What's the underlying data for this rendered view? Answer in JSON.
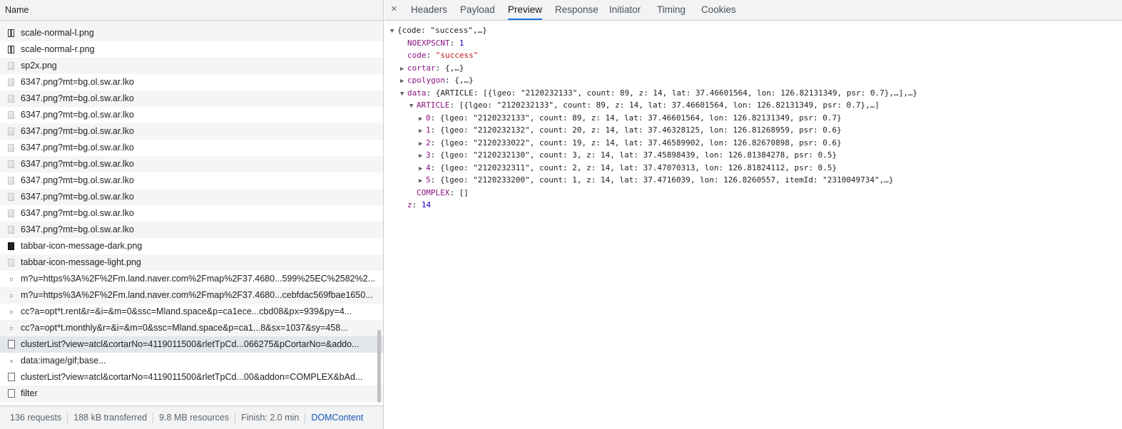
{
  "network": {
    "header": "Name",
    "requests": [
      {
        "name": "scale-normal-l.png",
        "icon": "bar-image-icon",
        "bg": "alt"
      },
      {
        "name": "scale-normal-r.png",
        "icon": "bar-image-icon",
        "bg": ""
      },
      {
        "name": "sp2x.png",
        "icon": "image-icon",
        "bg": "alt"
      },
      {
        "name": "6347.png?mt=bg.ol.sw.ar.lko",
        "icon": "image-icon",
        "bg": ""
      },
      {
        "name": "6347.png?mt=bg.ol.sw.ar.lko",
        "icon": "image-icon",
        "bg": "alt"
      },
      {
        "name": "6347.png?mt=bg.ol.sw.ar.lko",
        "icon": "image-icon",
        "bg": ""
      },
      {
        "name": "6347.png?mt=bg.ol.sw.ar.lko",
        "icon": "image-icon",
        "bg": "alt"
      },
      {
        "name": "6347.png?mt=bg.ol.sw.ar.lko",
        "icon": "image-icon",
        "bg": ""
      },
      {
        "name": "6347.png?mt=bg.ol.sw.ar.lko",
        "icon": "image-icon",
        "bg": "alt"
      },
      {
        "name": "6347.png?mt=bg.ol.sw.ar.lko",
        "icon": "image-icon",
        "bg": ""
      },
      {
        "name": "6347.png?mt=bg.ol.sw.ar.lko",
        "icon": "image-icon",
        "bg": "alt"
      },
      {
        "name": "6347.png?mt=bg.ol.sw.ar.lko",
        "icon": "image-icon",
        "bg": ""
      },
      {
        "name": "6347.png?mt=bg.ol.sw.ar.lko",
        "icon": "image-icon",
        "bg": "alt"
      },
      {
        "name": "tabbar-icon-message-dark.png",
        "icon": "dark-image-icon",
        "bg": ""
      },
      {
        "name": "tabbar-icon-message-light.png",
        "icon": "image-icon",
        "bg": "alt"
      },
      {
        "name": "m?u=https%3A%2F%2Fm.land.naver.com%2Fmap%2F37.4680...599%25EC%2582%2...",
        "icon": "dot-icon",
        "bg": ""
      },
      {
        "name": "m?u=https%3A%2F%2Fm.land.naver.com%2Fmap%2F37.4680...cebfdac569fbae1650...",
        "icon": "dot-icon",
        "bg": "alt"
      },
      {
        "name": "cc?a=opt*t.rent&r=&i=&m=0&ssc=Mland.space&p=ca1ece...cbd08&px=939&py=4...",
        "icon": "dot-icon",
        "bg": ""
      },
      {
        "name": "cc?a=opt*t.monthly&r=&i=&m=0&ssc=Mland.space&p=ca1...8&sx=1037&sy=458...",
        "icon": "dot-icon",
        "bg": "alt"
      },
      {
        "name": "clusterList?view=atcl&cortarNo=4119011500&rletTpCd...066275&pCortarNo=&addo...",
        "icon": "document-icon",
        "bg": "sel"
      },
      {
        "name": "data:image/gif;base...",
        "icon": "gif-icon",
        "bg": ""
      },
      {
        "name": "clusterList?view=atcl&cortarNo=4119011500&rletTpCd...00&addon=COMPLEX&bAd...",
        "icon": "document-icon",
        "bg": ""
      },
      {
        "name": "filter",
        "icon": "document-icon",
        "bg": "alt"
      }
    ],
    "status": {
      "requests": "136 requests",
      "transferred": "188 kB transferred",
      "resources": "9.8 MB resources",
      "finish": "Finish: 2.0 min",
      "domcontent": "DOMContent"
    }
  },
  "details": {
    "close_glyph": "×",
    "tabs": [
      "Headers",
      "Payload",
      "Preview",
      "Response",
      "Initiator",
      "Timing",
      "Cookies"
    ],
    "active_tab": "Preview",
    "preview": {
      "root": "{code: \"success\",…}",
      "noexpscnt_key": "NOEXPSCNT",
      "noexpscnt_val": "1",
      "code_key": "code",
      "code_val": "\"success\"",
      "cortar_key": "cortar",
      "cortar_val": "{,…}",
      "cpolygon_key": "cpolygon",
      "cpolygon_val": "{,…}",
      "data_key": "data",
      "data_val": "{ARTICLE: [{lgeo: \"2120232133\", count: 89, z: 14, lat: 37.46601564, lon: 126.82131349, psr: 0.7},…],…}",
      "article_key": "ARTICLE",
      "article_val": "[{lgeo: \"2120232133\", count: 89, z: 14, lat: 37.46601564, lon: 126.82131349, psr: 0.7},…]",
      "items": [
        {
          "k": "0",
          "v": "{lgeo: \"2120232133\", count: 89, z: 14, lat: 37.46601564, lon: 126.82131349, psr: 0.7}"
        },
        {
          "k": "1",
          "v": "{lgeo: \"2120232132\", count: 20, z: 14, lat: 37.46328125, lon: 126.81268959, psr: 0.6}"
        },
        {
          "k": "2",
          "v": "{lgeo: \"2120233022\", count: 19, z: 14, lat: 37.46589902, lon: 126.82670898, psr: 0.6}"
        },
        {
          "k": "3",
          "v": "{lgeo: \"2120232130\", count: 3, z: 14, lat: 37.45898439, lon: 126.81384278, psr: 0.5}"
        },
        {
          "k": "4",
          "v": "{lgeo: \"2120232311\", count: 2, z: 14, lat: 37.47070313, lon: 126.81824112, psr: 0.5}"
        },
        {
          "k": "5",
          "v": "{lgeo: \"2120233200\", count: 1, z: 14, lat: 37.4716039, lon: 126.8260557, itemId: \"2310049734\",…}"
        }
      ],
      "complex_key": "COMPLEX",
      "complex_val": "[]",
      "z_key": "z",
      "z_val": "14"
    }
  }
}
